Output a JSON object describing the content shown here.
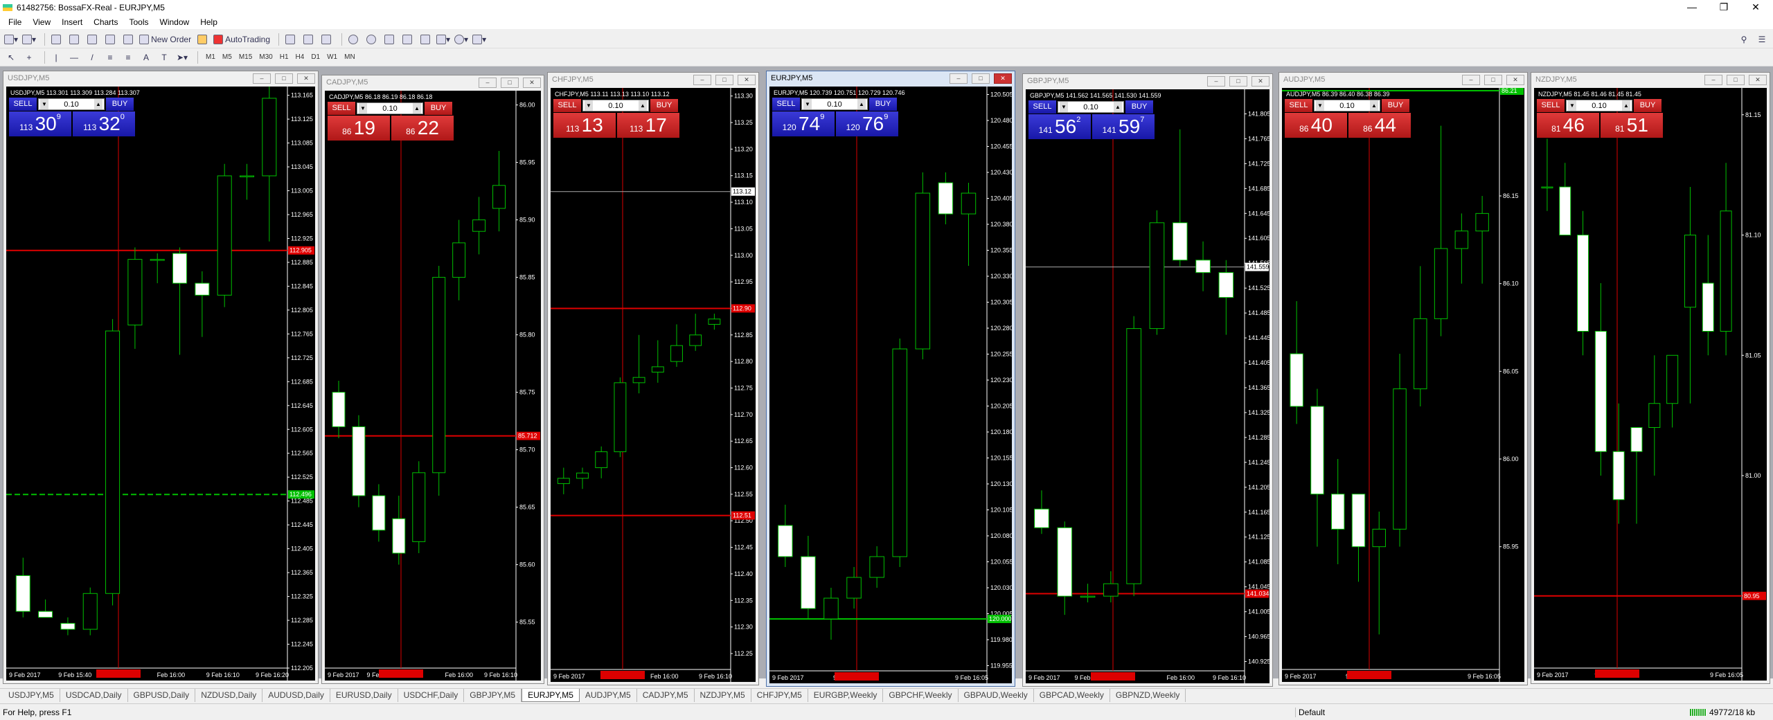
{
  "app": {
    "title": "61482756: BossaFX-Real - EURJPY,M5"
  },
  "menu": [
    "File",
    "View",
    "Insert",
    "Charts",
    "Tools",
    "Window",
    "Help"
  ],
  "toolbar": {
    "new_order": "New Order",
    "autotrading": "AutoTrading",
    "timeframes": [
      "M1",
      "M5",
      "M15",
      "M30",
      "H1",
      "H4",
      "D1",
      "W1",
      "MN"
    ]
  },
  "colors": {
    "bull": "#00c000",
    "sell_panel_red": "#c82020",
    "sell_panel_blue": "#2020c0",
    "active_border": "#4b6fa8"
  },
  "windows": [
    {
      "title": "USDJPY,M5",
      "info": "USDJPY,M5  113.301 113.309 113.284 113.307",
      "panel": "blue",
      "lot": "0.10",
      "sell": "SELL",
      "buy": "BUY",
      "bid": {
        "small": "113",
        "big": "30",
        "sup": "9"
      },
      "ask": {
        "small": "113",
        "big": "32",
        "sup": "0"
      },
      "yticks": [
        "113.165",
        "113.125",
        "113.085",
        "113.045",
        "113.005",
        "112.965",
        "112.925",
        "112.885",
        "112.845",
        "112.805",
        "112.765",
        "112.725",
        "112.685",
        "112.645",
        "112.605",
        "112.565",
        "112.525",
        "112.485",
        "112.445",
        "112.405",
        "112.365",
        "112.325",
        "112.285",
        "112.245",
        "112.205"
      ],
      "xticks": [
        "9 Feb 2017",
        "9 Feb 15:40",
        "",
        "Feb 16:00",
        "9 Feb 16:10",
        "9 Feb 16:20"
      ],
      "markers": [
        {
          "label": "112.905",
          "type": "line"
        },
        {
          "label": "112.496",
          "type": "green"
        }
      ],
      "candles": [
        [
          112.36,
          112.39,
          112.29,
          112.3
        ],
        [
          112.3,
          112.32,
          112.29,
          112.29
        ],
        [
          112.28,
          112.29,
          112.26,
          112.27
        ],
        [
          112.27,
          112.34,
          112.26,
          112.33
        ],
        [
          112.33,
          112.79,
          112.31,
          112.77
        ],
        [
          112.78,
          112.91,
          112.74,
          112.89
        ],
        [
          112.89,
          112.9,
          112.85,
          112.89
        ],
        [
          112.9,
          112.91,
          112.73,
          112.85
        ],
        [
          112.85,
          112.87,
          112.76,
          112.83
        ],
        [
          112.83,
          113.05,
          112.81,
          113.03
        ],
        [
          113.03,
          113.05,
          112.99,
          113.03
        ],
        [
          113.03,
          113.18,
          112.92,
          113.16
        ]
      ],
      "ylim": [
        112.205,
        113.175
      ]
    },
    {
      "title": "CADJPY,M5",
      "info": "CADJPY,M5  86.18 86.19 86.18 86.18",
      "panel": "red",
      "lot": "0.10",
      "sell": "SELL",
      "buy": "BUY",
      "bid": {
        "small": "86",
        "big": "19",
        "sup": ""
      },
      "ask": {
        "small": "86",
        "big": "22",
        "sup": ""
      },
      "yticks": [
        "86.00",
        "85.95",
        "85.90",
        "85.85",
        "85.80",
        "85.75",
        "85.70",
        "85.65",
        "85.60",
        "85.55"
      ],
      "xticks": [
        "9 Feb 2017",
        "9 Feb 15:40",
        "",
        "Feb 16:00",
        "9 Feb 16:10"
      ],
      "markers": [
        {
          "label": "85.712",
          "type": "line"
        }
      ],
      "candles": [
        [
          85.75,
          85.76,
          85.71,
          85.72
        ],
        [
          85.72,
          85.73,
          85.65,
          85.66
        ],
        [
          85.66,
          85.67,
          85.62,
          85.63
        ],
        [
          85.64,
          85.66,
          85.6,
          85.61
        ],
        [
          85.62,
          85.69,
          85.61,
          85.68
        ],
        [
          85.68,
          85.86,
          85.66,
          85.85
        ],
        [
          85.85,
          85.9,
          85.83,
          85.88
        ],
        [
          85.89,
          85.92,
          85.87,
          85.9
        ],
        [
          85.91,
          85.96,
          85.89,
          85.93
        ]
      ],
      "ylim": [
        85.51,
        86.01
      ]
    },
    {
      "title": "CHFJPY,M5",
      "info": "CHFJPY,M5  113.11 113.13 113.10 113.12",
      "panel": "red",
      "lot": "0.10",
      "sell": "SELL",
      "buy": "BUY",
      "bid": {
        "small": "113",
        "big": "13",
        "sup": ""
      },
      "ask": {
        "small": "113",
        "big": "17",
        "sup": ""
      },
      "yticks": [
        "113.30",
        "113.25",
        "113.20",
        "113.15",
        "113.10",
        "113.05",
        "113.00",
        "112.95",
        "112.90",
        "112.85",
        "112.80",
        "112.75",
        "112.70",
        "112.65",
        "112.60",
        "112.55",
        "112.50",
        "112.45",
        "112.40",
        "112.35",
        "112.30",
        "112.25"
      ],
      "xticks": [
        "9 Feb 2017",
        "",
        "Feb 16:00",
        "9 Feb 16:10"
      ],
      "markers": [
        {
          "label": "113.12",
          "type": "white"
        },
        {
          "label": "112.90",
          "type": "line"
        },
        {
          "label": "112.51",
          "type": "line"
        }
      ],
      "candles": [
        [
          112.57,
          112.6,
          112.55,
          112.58
        ],
        [
          112.58,
          112.6,
          112.56,
          112.59
        ],
        [
          112.6,
          112.64,
          112.58,
          112.63
        ],
        [
          112.63,
          112.77,
          112.62,
          112.76
        ],
        [
          112.76,
          112.85,
          112.74,
          112.77
        ],
        [
          112.78,
          112.84,
          112.76,
          112.79
        ],
        [
          112.8,
          112.87,
          112.79,
          112.83
        ],
        [
          112.83,
          112.89,
          112.82,
          112.85
        ],
        [
          112.87,
          112.89,
          112.86,
          112.88
        ]
      ],
      "ylim": [
        112.22,
        113.31
      ]
    },
    {
      "title": "EURJPY,M5",
      "info": "EURJPY,M5  120.739 120.751 120.729 120.746",
      "panel": "blue",
      "lot": "0.10",
      "sell": "SELL",
      "buy": "BUY",
      "bid": {
        "small": "120",
        "big": "74",
        "sup": "9"
      },
      "ask": {
        "small": "120",
        "big": "76",
        "sup": "9"
      },
      "yticks": [
        "120.505",
        "120.480",
        "120.455",
        "120.430",
        "120.405",
        "120.380",
        "120.355",
        "120.330",
        "120.305",
        "120.280",
        "120.255",
        "120.230",
        "120.205",
        "120.180",
        "120.155",
        "120.130",
        "120.105",
        "120.080",
        "120.055",
        "120.030",
        "120.005",
        "119.980",
        "119.955"
      ],
      "xticks": [
        "9 Feb 2017",
        "9 Feb 15:35",
        "",
        "9 Feb 16:05"
      ],
      "markers": [
        {
          "label": "120.000",
          "type": "green"
        }
      ],
      "candles": [
        [
          120.09,
          120.11,
          120.05,
          120.06
        ],
        [
          120.06,
          120.08,
          120.0,
          120.01
        ],
        [
          120.0,
          120.03,
          119.98,
          120.02
        ],
        [
          120.02,
          120.05,
          120.01,
          120.04
        ],
        [
          120.04,
          120.07,
          120.03,
          120.06
        ],
        [
          120.06,
          120.27,
          120.05,
          120.26
        ],
        [
          120.26,
          120.43,
          120.25,
          120.41
        ],
        [
          120.42,
          120.43,
          120.38,
          120.39
        ],
        [
          120.39,
          120.42,
          120.34,
          120.41
        ]
      ],
      "ylim": [
        119.95,
        120.51
      ]
    },
    {
      "title": "GBPJPY,M5",
      "info": "GBPJPY,M5  141.562 141.565 141.530 141.559",
      "panel": "blue",
      "lot": "0.10",
      "sell": "SELL",
      "buy": "BUY",
      "bid": {
        "small": "141",
        "big": "56",
        "sup": "2"
      },
      "ask": {
        "small": "141",
        "big": "59",
        "sup": "7"
      },
      "yticks": [
        "141.805",
        "141.765",
        "141.725",
        "141.685",
        "141.645",
        "141.605",
        "141.565",
        "141.525",
        "141.485",
        "141.445",
        "141.405",
        "141.365",
        "141.325",
        "141.285",
        "141.245",
        "141.205",
        "141.165",
        "141.125",
        "141.085",
        "141.045",
        "141.005",
        "140.965",
        "140.925"
      ],
      "xticks": [
        "9 Feb 2017",
        "9 Feb 15:40",
        "",
        "Feb 16:00",
        "9 Feb 16:10"
      ],
      "markers": [
        {
          "label": "141.559",
          "type": "white"
        },
        {
          "label": "141.034",
          "type": "line"
        }
      ],
      "candles": [
        [
          141.17,
          141.2,
          141.13,
          141.14
        ],
        [
          141.14,
          141.15,
          141.0,
          141.03
        ],
        [
          141.03,
          141.05,
          141.02,
          141.03
        ],
        [
          141.03,
          141.07,
          141.02,
          141.05
        ],
        [
          141.05,
          141.48,
          141.03,
          141.46
        ],
        [
          141.46,
          141.65,
          141.45,
          141.63
        ],
        [
          141.63,
          141.78,
          141.56,
          141.57
        ],
        [
          141.57,
          141.6,
          141.52,
          141.55
        ],
        [
          141.55,
          141.57,
          141.45,
          141.51
        ]
      ],
      "ylim": [
        140.91,
        141.84
      ]
    },
    {
      "title": "AUDJPY,M5",
      "info": "AUDJPY,M5  86.39 86.40 86.38 86.39",
      "panel": "red",
      "lot": "0.10",
      "sell": "SELL",
      "buy": "BUY",
      "bid": {
        "small": "86",
        "big": "40",
        "sup": ""
      },
      "ask": {
        "small": "86",
        "big": "44",
        "sup": ""
      },
      "yticks": [
        "86.15",
        "86.10",
        "86.05",
        "86.00",
        "85.95"
      ],
      "xticks": [
        "9 Feb 2017",
        "9 Feb 15:05",
        "",
        "9 Feb 16:05"
      ],
      "markers": [
        {
          "label": "86.21",
          "type": "green"
        }
      ],
      "candles": [
        [
          86.06,
          86.09,
          86.02,
          86.03
        ],
        [
          86.03,
          86.04,
          85.95,
          85.98
        ],
        [
          85.98,
          86.0,
          85.94,
          85.96
        ],
        [
          85.98,
          85.98,
          85.93,
          85.95
        ],
        [
          85.95,
          85.97,
          85.9,
          85.96
        ],
        [
          85.96,
          86.06,
          85.95,
          86.04
        ],
        [
          86.04,
          86.11,
          86.03,
          86.08
        ],
        [
          86.08,
          86.19,
          86.07,
          86.12
        ],
        [
          86.12,
          86.14,
          86.1,
          86.13
        ],
        [
          86.13,
          86.15,
          86.1,
          86.14
        ]
      ],
      "ylim": [
        85.88,
        86.21
      ]
    },
    {
      "title": "NZDJPY,M5",
      "info": "NZDJPY,M5  81.45 81.46 81.45 81.45",
      "panel": "red",
      "lot": "0.10",
      "sell": "SELL",
      "buy": "BUY",
      "bid": {
        "small": "81",
        "big": "46",
        "sup": ""
      },
      "ask": {
        "small": "81",
        "big": "51",
        "sup": ""
      },
      "yticks": [
        "81.15",
        "81.10",
        "81.05",
        "81.00",
        "80.95"
      ],
      "xticks": [
        "9 Feb 2017",
        "9 Feb 15:55",
        "",
        "9 Feb 16:05"
      ],
      "markers": [
        {
          "label": "80.95",
          "type": "line"
        }
      ],
      "candles": [
        [
          81.12,
          81.14,
          81.11,
          81.12
        ],
        [
          81.12,
          81.13,
          81.1,
          81.1
        ],
        [
          81.1,
          81.11,
          81.05,
          81.06
        ],
        [
          81.06,
          81.08,
          81.0,
          81.01
        ],
        [
          81.01,
          81.03,
          80.98,
          80.99
        ],
        [
          81.02,
          81.02,
          80.98,
          81.01
        ],
        [
          81.02,
          81.05,
          81.0,
          81.03
        ],
        [
          81.03,
          81.05,
          81.02,
          81.05
        ],
        [
          81.07,
          81.12,
          81.03,
          81.1
        ],
        [
          81.08,
          81.1,
          81.05,
          81.06
        ],
        [
          81.06,
          81.13,
          81.05,
          81.11
        ]
      ],
      "ylim": [
        80.92,
        81.16
      ]
    }
  ],
  "tabs": [
    "USDJPY,M5",
    "USDCAD,Daily",
    "GBPUSD,Daily",
    "NZDUSD,Daily",
    "AUDUSD,Daily",
    "EURUSD,Daily",
    "USDCHF,Daily",
    "GBPJPY,M5",
    "EURJPY,M5",
    "AUDJPY,M5",
    "CADJPY,M5",
    "NZDJPY,M5",
    "CHFJPY,M5",
    "EURGBP,Weekly",
    "GBPCHF,Weekly",
    "GBPAUD,Weekly",
    "GBPCAD,Weekly",
    "GBPNZD,Weekly"
  ],
  "active_tab": "EURJPY,M5",
  "status": {
    "help": "For Help, press F1",
    "profile": "Default",
    "traffic": "49772/18 kb"
  }
}
